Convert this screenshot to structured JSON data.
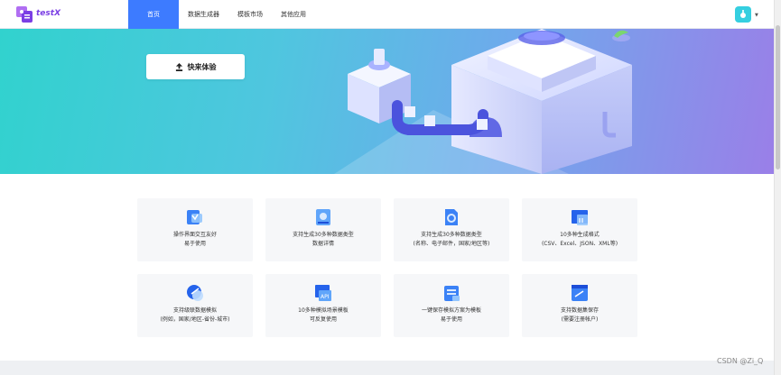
{
  "brand": {
    "name": "testX"
  },
  "nav": {
    "items": [
      {
        "label": "首页"
      },
      {
        "label": "数据生成器"
      },
      {
        "label": "模板市场"
      },
      {
        "label": "其他应用"
      }
    ]
  },
  "hero": {
    "cta_label": "快来体验"
  },
  "features": [
    {
      "line1": "操作界面交互友好",
      "line2": "易于使用"
    },
    {
      "line1": "支持生成30多种数据类型",
      "line2": "数据详情"
    },
    {
      "line1": "支持生成30多种数据类型",
      "line2": "(名称、电子邮件，国家/地区等)"
    },
    {
      "line1": "10多种生成格式",
      "line2": "(CSV、Excel、JSON、XML等)"
    },
    {
      "line1": "支持级联数据模拟",
      "line2": "(例如，国家/地区-省份-城市)"
    },
    {
      "line1": "10多种模拟场景模板",
      "line2": "可反复使用"
    },
    {
      "line1": "一键保存模拟方案为模板",
      "line2": "易于使用"
    },
    {
      "line1": "支持数据集保存",
      "line2": "(需要注册帐户)"
    }
  ],
  "watermark": "CSDN @Zi_Q",
  "colors": {
    "primary": "#3d7bff",
    "hero_start": "#31d2ce",
    "hero_end": "#9a7fe8"
  }
}
